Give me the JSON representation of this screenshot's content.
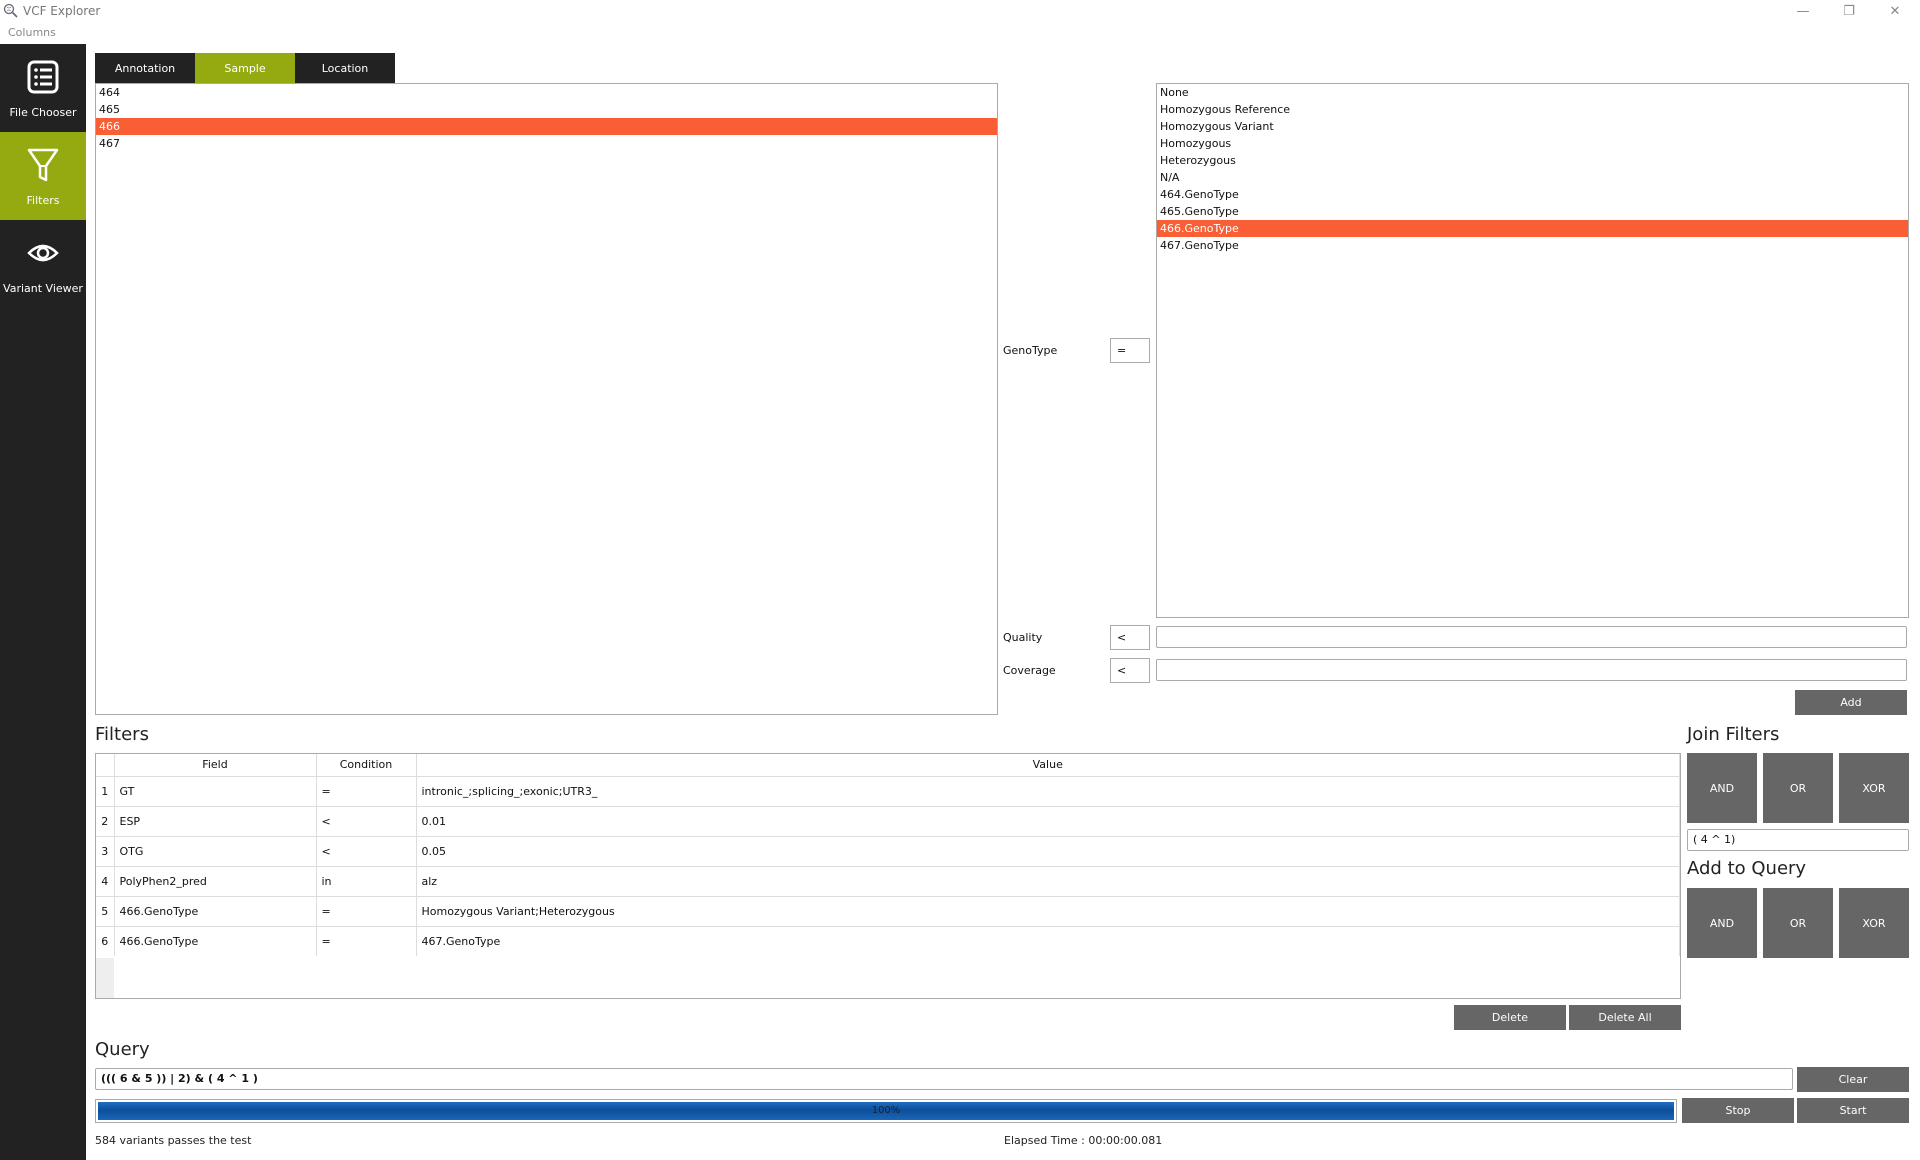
{
  "window": {
    "title": "VCF Explorer",
    "controls": {
      "minimize": "—",
      "restore": "❐",
      "close": "✕"
    }
  },
  "menu": {
    "items": [
      "Columns"
    ]
  },
  "sidebar": {
    "items": [
      {
        "label": "File Chooser",
        "icon": "list-icon",
        "active": false
      },
      {
        "label": "Filters",
        "icon": "filter-icon",
        "active": true
      },
      {
        "label": "Variant Viewer",
        "icon": "eye-icon",
        "active": false
      }
    ]
  },
  "tabs": [
    {
      "label": "Annotation",
      "active": false
    },
    {
      "label": "Sample",
      "active": true
    },
    {
      "label": "Location",
      "active": false
    }
  ],
  "sample_list": {
    "items": [
      "464",
      "465",
      "466",
      "467"
    ],
    "selected_index": 2
  },
  "genotype_panel": {
    "genotype_label": "GenoType",
    "genotype_operator": "=",
    "options": [
      "None",
      "Homozygous Reference",
      "Homozygous Variant",
      "Homozygous",
      "Heterozygous",
      "N/A",
      "464.GenoType",
      "465.GenoType",
      "466.GenoType",
      "467.GenoType"
    ],
    "selected_index": 8,
    "quality_label": "Quality",
    "quality_operator": "<",
    "quality_value": "",
    "coverage_label": "Coverage",
    "coverage_operator": "<",
    "coverage_value": "",
    "add_label": "Add"
  },
  "filters": {
    "title": "Filters",
    "columns": [
      "Field",
      "Condition",
      "Value"
    ],
    "rows": [
      {
        "index": "1",
        "field": "GT",
        "condition": "=",
        "value": "intronic_;splicing_;exonic;UTR3_"
      },
      {
        "index": "2",
        "field": "ESP",
        "condition": "<",
        "value": "0.01"
      },
      {
        "index": "3",
        "field": "OTG",
        "condition": "<",
        "value": "0.05"
      },
      {
        "index": "4",
        "field": "PolyPhen2_pred",
        "condition": "in",
        "value": "alz"
      },
      {
        "index": "5",
        "field": "466.GenoType",
        "condition": "=",
        "value": "Homozygous Variant;Heterozygous"
      },
      {
        "index": "6",
        "field": "466.GenoType",
        "condition": "=",
        "value": "467.GenoType"
      }
    ],
    "delete_label": "Delete",
    "delete_all_label": "Delete All"
  },
  "join_filters": {
    "title": "Join Filters",
    "buttons": [
      "AND",
      "OR",
      "XOR"
    ],
    "expression": "( 4 ^ 1)"
  },
  "add_to_query": {
    "title": "Add to Query",
    "buttons": [
      "AND",
      "OR",
      "XOR"
    ]
  },
  "query": {
    "title": "Query",
    "expression": "((( 6 & 5 )) | 2) & ( 4 ^ 1 )",
    "clear_label": "Clear",
    "progress_percent": 100,
    "progress_text": "100%",
    "stop_label": "Stop",
    "start_label": "Start",
    "result_text": "584 variants passes the test",
    "elapsed_text": "Elapsed Time : 00:00:00.081"
  },
  "colors": {
    "accent_green": "#94aa10",
    "selection_orange": "#f95e34",
    "sidebar_dark": "#222222",
    "button_gray": "#666666",
    "progress_blue": "#0d4f9a"
  }
}
